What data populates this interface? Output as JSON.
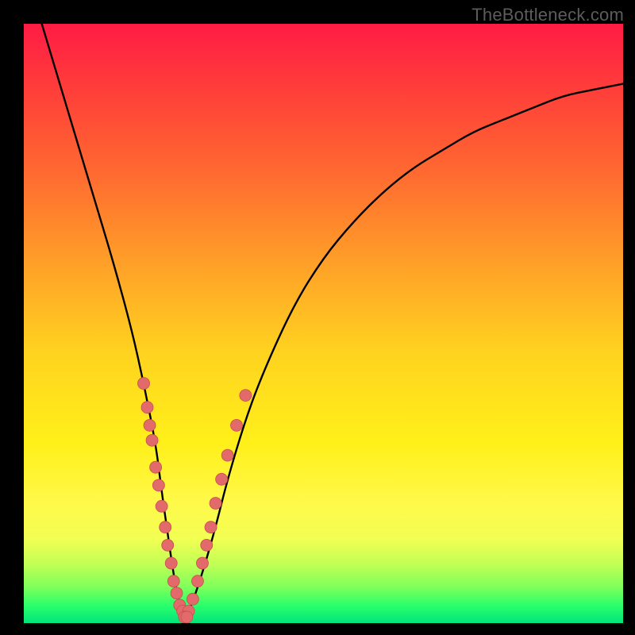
{
  "watermark": "TheBottleneck.com",
  "gradient": {
    "top": "#ff1c44",
    "mid": "#fff01a",
    "bottom": "#00e57a"
  },
  "chart_data": {
    "type": "line",
    "title": "",
    "xlabel": "",
    "ylabel": "",
    "xlim": [
      0,
      100
    ],
    "ylim": [
      0,
      100
    ],
    "series": [
      {
        "name": "curve",
        "x": [
          3,
          6,
          9,
          12,
          15,
          18,
          20,
          22,
          23,
          24,
          25,
          26,
          27,
          28,
          30,
          32,
          34,
          37,
          40,
          45,
          50,
          55,
          60,
          65,
          70,
          75,
          80,
          85,
          90,
          95,
          100
        ],
        "y": [
          100,
          90,
          80,
          70,
          60,
          49,
          40,
          30,
          22,
          15,
          8,
          3,
          1,
          3,
          9,
          16,
          24,
          34,
          42,
          53,
          61,
          67,
          72,
          76,
          79,
          82,
          84,
          86,
          88,
          89,
          90
        ]
      },
      {
        "name": "left-branch-dots",
        "type": "scatter",
        "x": [
          20.0,
          20.6,
          21.0,
          21.4,
          22.0,
          22.5,
          23.0,
          23.6,
          24.0,
          24.6,
          25.0,
          25.5,
          26.0,
          26.5
        ],
        "y": [
          40.0,
          36.0,
          33.0,
          30.5,
          26.0,
          23.0,
          19.5,
          16.0,
          13.0,
          10.0,
          7.0,
          5.0,
          3.0,
          2.0
        ]
      },
      {
        "name": "right-branch-dots",
        "type": "scatter",
        "x": [
          27.5,
          28.2,
          29.0,
          29.8,
          30.5,
          31.2,
          32.0,
          33.0,
          34.0,
          35.5,
          37.0
        ],
        "y": [
          2.0,
          4.0,
          7.0,
          10.0,
          13.0,
          16.0,
          20.0,
          24.0,
          28.0,
          33.0,
          38.0
        ]
      },
      {
        "name": "valley-dots",
        "type": "scatter",
        "x": [
          26.8,
          27.2
        ],
        "y": [
          1.0,
          1.0
        ]
      }
    ]
  }
}
